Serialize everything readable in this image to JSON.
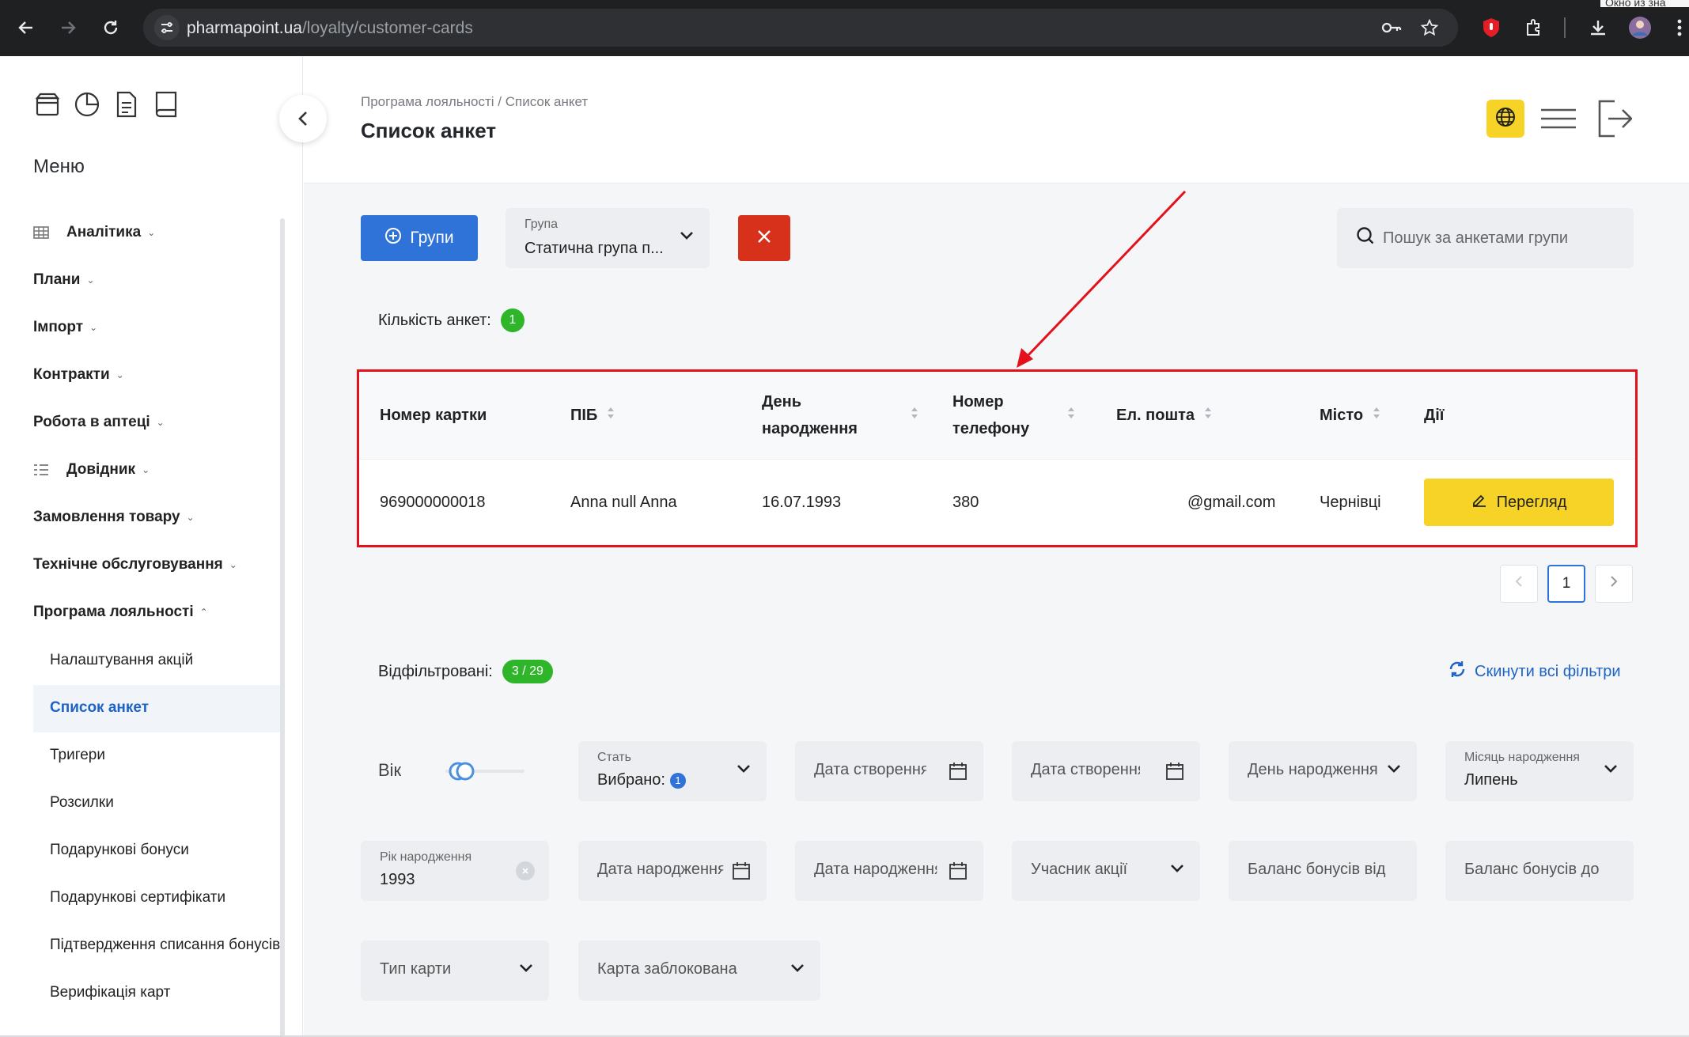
{
  "browser": {
    "url_host": "pharmapoint.ua",
    "url_path": "/loyalty/customer-cards",
    "tooltip_fragment": "Окно из зна"
  },
  "sidebar": {
    "title": "Меню",
    "items": [
      {
        "label": "Аналітика"
      },
      {
        "label": "Плани"
      },
      {
        "label": "Імпорт"
      },
      {
        "label": "Контракти"
      },
      {
        "label": "Робота в аптеці"
      },
      {
        "label": "Довідник"
      },
      {
        "label": "Замовлення товару"
      },
      {
        "label": "Технічне обслуговування"
      },
      {
        "label": "Програма лояльності"
      }
    ],
    "sub_items": [
      {
        "label": "Налаштування акцій"
      },
      {
        "label": "Список анкет"
      },
      {
        "label": "Тригери"
      },
      {
        "label": "Розсилки"
      },
      {
        "label": "Подарункові бонуси"
      },
      {
        "label": "Подарункові сертифікати"
      },
      {
        "label": "Підтвердження списання бонусів"
      },
      {
        "label": "Верифікація карт"
      }
    ]
  },
  "header": {
    "breadcrumb": "Програма лояльності / Список анкет",
    "title": "Список анкет"
  },
  "toolbar": {
    "groups_label": "Групи",
    "group_select_label": "Група",
    "group_select_value": "Статична група п...",
    "search_placeholder": "Пошук за анкетами групи"
  },
  "count": {
    "label": "Кількість анкет:",
    "value": "1"
  },
  "table": {
    "headers": [
      "Номер картки",
      "ПІБ",
      "День народження",
      "Номер телефону",
      "Ел. пошта",
      "Місто",
      "Дії"
    ],
    "rows": [
      {
        "card": "969000000018",
        "name": "Anna null Anna",
        "birthday": "16.07.1993",
        "phone": "380",
        "email": "@gmail.com",
        "city": "Чернівці",
        "action": "Перегляд"
      }
    ]
  },
  "pagination": {
    "current": "1"
  },
  "filters": {
    "filtered_label": "Відфільтровані:",
    "filtered_value": "3 / 29",
    "reset_label": "Скинути всі фільтри",
    "age_label": "Вік",
    "sex_label": "Стать",
    "sex_value": "Вибрано:",
    "sex_count": "1",
    "created_from": "Дата створення від",
    "created_to": "Дата створення до",
    "birth_day": "День народження",
    "birth_month_label": "Місяць народження",
    "birth_month_value": "Липень",
    "birth_year_label": "Рік народження",
    "birth_year_value": "1993",
    "birth_date_from": "Дата народження від",
    "birth_date_to": "Дата народження до",
    "promo_participant": "Учасник акції",
    "bonus_from": "Баланс бонусів від",
    "bonus_to": "Баланс бонусів до",
    "card_type": "Тип карти",
    "card_blocked": "Карта заблокована"
  },
  "colors": {
    "primary": "#2f73d9",
    "accent_yellow": "#f6d326",
    "danger": "#d7301b",
    "success": "#2fb52a",
    "annotation_red": "#e4101b"
  }
}
